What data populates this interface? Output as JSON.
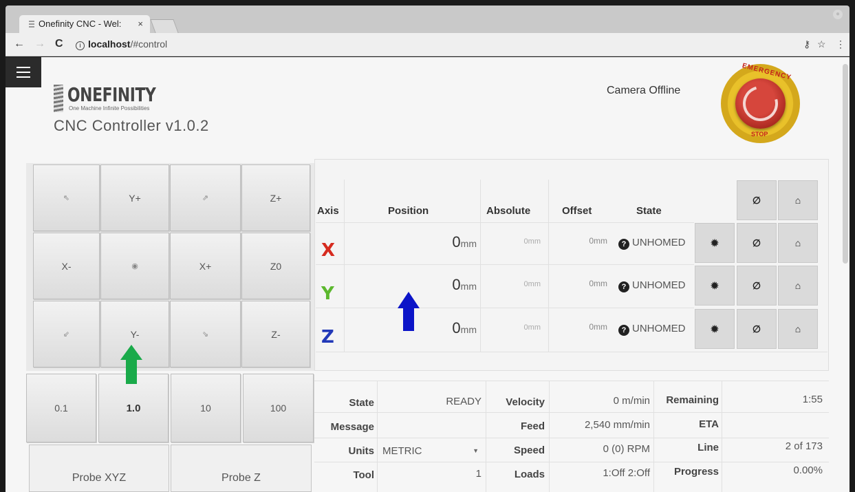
{
  "browser": {
    "tab_title": "Onefinity CNC - Wel:",
    "tab_close": "×",
    "url_host": "localhost",
    "url_path": "/#control"
  },
  "header": {
    "logo_word": "ONEFINITY",
    "logo_tagline": "One Machine Infinite Possibilities",
    "controller_title": "CNC Controller v1.0.2",
    "camera_status": "Camera Offline",
    "estop_top": "EMERGENCY",
    "estop_bottom": "STOP"
  },
  "jog": {
    "y_plus": "Y+",
    "z_plus": "Z+",
    "x_minus": "X-",
    "x_plus": "X+",
    "z_zero": "Z0",
    "y_minus": "Y-",
    "z_minus": "Z-",
    "center": "◉",
    "diag_ul": "⇖",
    "diag_ur": "⇗",
    "diag_dl": "⇙",
    "diag_dr": "⇘",
    "steps": [
      "0.1",
      "1.0",
      "10",
      "100"
    ],
    "selected_step": "1.0"
  },
  "probe": {
    "xyz": "Probe XYZ",
    "z": "Probe Z"
  },
  "axes": {
    "headers": {
      "axis": "Axis",
      "position": "Position",
      "absolute": "Absolute",
      "offset": "Offset",
      "state": "State"
    },
    "rows": [
      {
        "name": "X",
        "color": "#d62b1f",
        "position": "0",
        "unit": "mm",
        "absolute": "0mm",
        "offset": "0mm",
        "state": "UNHOMED"
      },
      {
        "name": "Y",
        "color": "#5cb82e",
        "position": "0",
        "unit": "mm",
        "absolute": "0mm",
        "offset": "0mm",
        "state": "UNHOMED"
      },
      {
        "name": "Z",
        "color": "#2239b8",
        "position": "0",
        "unit": "mm",
        "absolute": "0mm",
        "offset": "0mm",
        "state": "UNHOMED"
      }
    ],
    "settings_glyph": "✹",
    "zero_glyph": "∅",
    "home_glyph": "⌂"
  },
  "status": {
    "state_label": "State",
    "state_value": "READY",
    "message_label": "Message",
    "message_value": "",
    "units_label": "Units",
    "units_value": "METRIC",
    "tool_label": "Tool",
    "tool_value": "1",
    "velocity_label": "Velocity",
    "velocity_value": "0 m/min",
    "feed_label": "Feed",
    "feed_value": "2,540 mm/min",
    "speed_label": "Speed",
    "speed_value": "0 (0) RPM",
    "loads_label": "Loads",
    "loads_value": "1:Off 2:Off",
    "remaining_label": "Remaining",
    "remaining_value": "1:55",
    "eta_label": "ETA",
    "eta_value": "",
    "line_label": "Line",
    "line_value": "2 of 173",
    "progress_label": "Progress",
    "progress_value": "0.00%"
  },
  "annotations": {
    "green_arrow_color": "#1aaa4a",
    "blue_arrow_color": "#0b14c8"
  }
}
